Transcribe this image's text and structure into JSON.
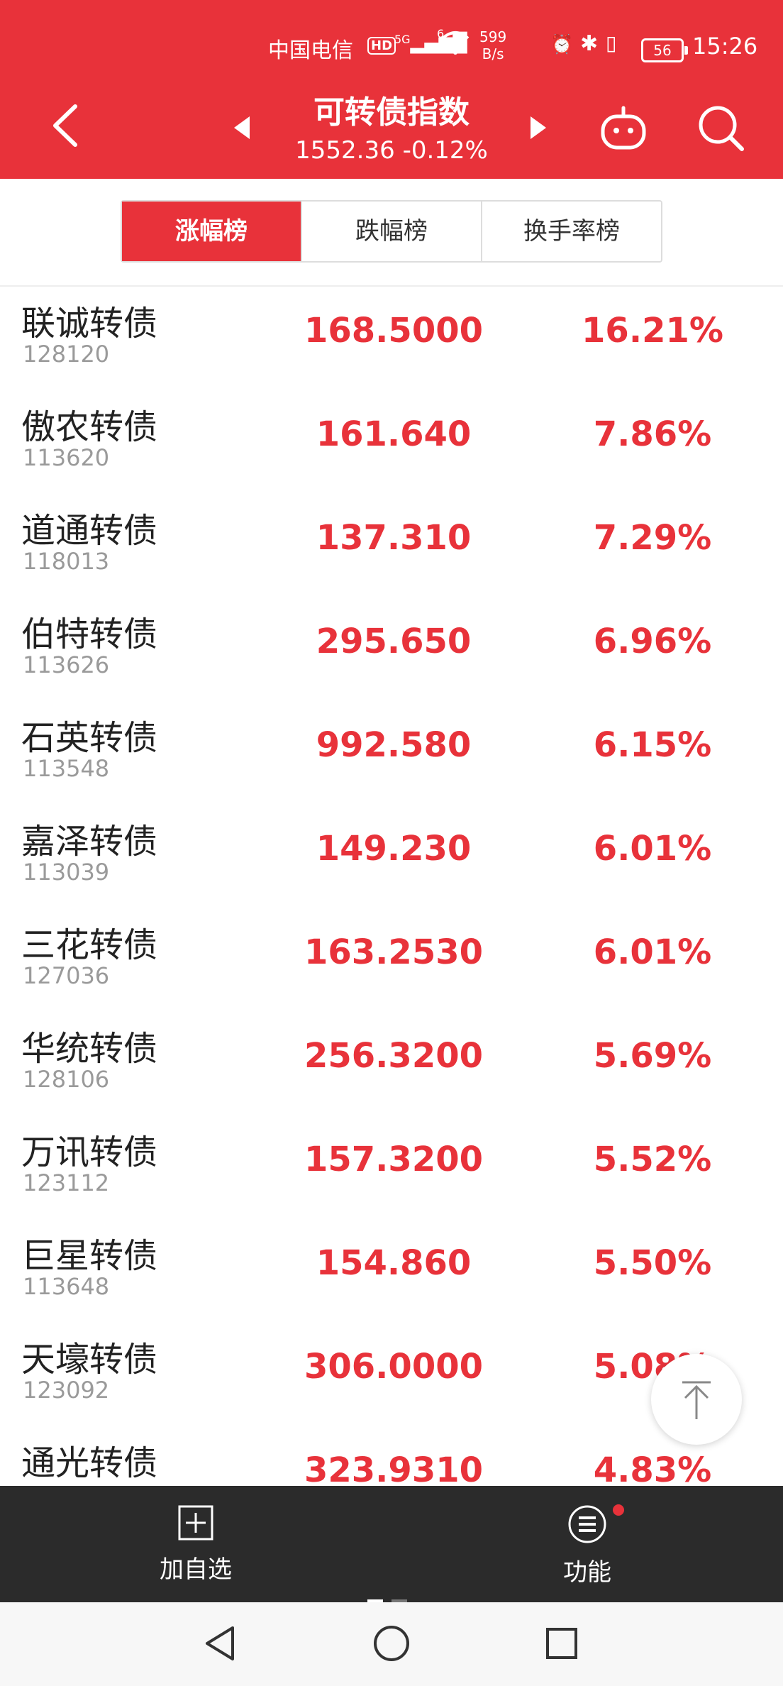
{
  "status_bar": {
    "carrier": "中国电信",
    "hd": "HD",
    "signal": "5G",
    "wifi_gen": "6",
    "net_speed": "599",
    "net_unit": "B/s",
    "battery": "56",
    "time": "15:26"
  },
  "header": {
    "title": "可转债指数",
    "subtitle": "1552.36  -0.12%"
  },
  "tabs": [
    {
      "label": "涨幅榜",
      "active": true
    },
    {
      "label": "跌幅榜",
      "active": false
    },
    {
      "label": "换手率榜",
      "active": false
    }
  ],
  "rows": [
    {
      "name": "联诚转债",
      "code": "128120",
      "price": "168.5000",
      "change": "16.21%"
    },
    {
      "name": "傲农转债",
      "code": "113620",
      "price": "161.640",
      "change": "7.86%"
    },
    {
      "name": "道通转债",
      "code": "118013",
      "price": "137.310",
      "change": "7.29%"
    },
    {
      "name": "伯特转债",
      "code": "113626",
      "price": "295.650",
      "change": "6.96%"
    },
    {
      "name": "石英转债",
      "code": "113548",
      "price": "992.580",
      "change": "6.15%"
    },
    {
      "name": "嘉泽转债",
      "code": "113039",
      "price": "149.230",
      "change": "6.01%"
    },
    {
      "name": "三花转债",
      "code": "127036",
      "price": "163.2530",
      "change": "6.01%"
    },
    {
      "name": "华统转债",
      "code": "128106",
      "price": "256.3200",
      "change": "5.69%"
    },
    {
      "name": "万讯转债",
      "code": "123112",
      "price": "157.3200",
      "change": "5.52%"
    },
    {
      "name": "巨星转债",
      "code": "113648",
      "price": "154.860",
      "change": "5.50%"
    },
    {
      "name": "天壕转债",
      "code": "123092",
      "price": "306.0000",
      "change": "5.08%"
    },
    {
      "name": "通光转债",
      "code": "",
      "price": "323.9310",
      "change": "4.83%"
    }
  ],
  "toolbar": {
    "add_label": "加自选",
    "func_label": "功能"
  },
  "colors": {
    "brand_red": "#E8323A",
    "toolbar_bg": "#2b2b2b"
  }
}
